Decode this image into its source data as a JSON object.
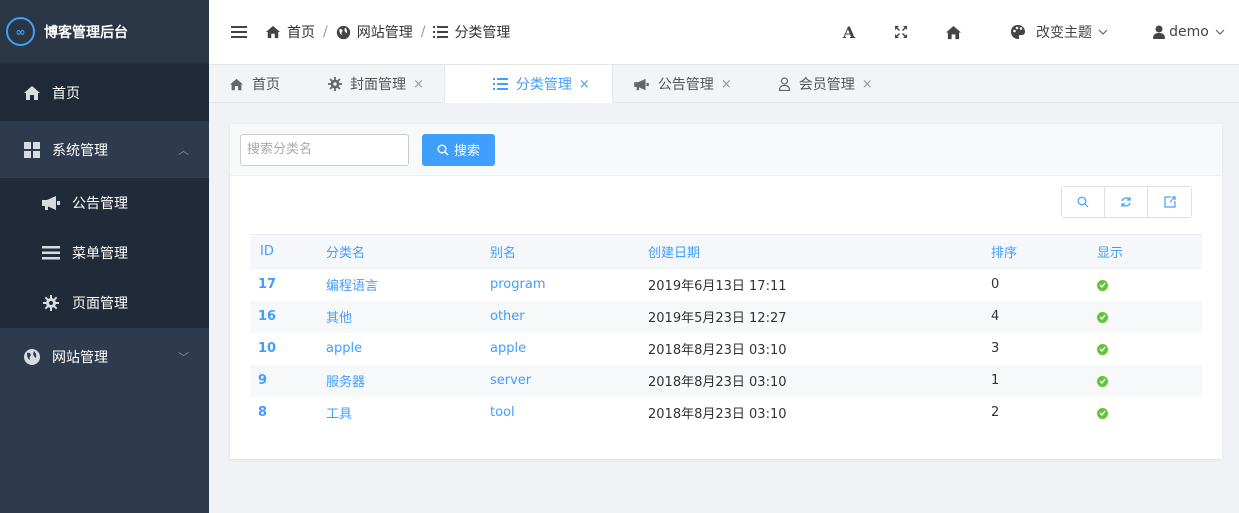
{
  "app": {
    "title": "博客管理后台",
    "logo_text": "∞"
  },
  "sidebar": {
    "items": [
      {
        "label": "首页"
      },
      {
        "label": "系统管理",
        "arrow": "︿"
      },
      {
        "label": "网站管理",
        "arrow": "﹀"
      }
    ],
    "sub_items": [
      {
        "label": "公告管理"
      },
      {
        "label": "菜单管理"
      },
      {
        "label": "页面管理"
      }
    ]
  },
  "header": {
    "breadcrumb": [
      "首页",
      "网站管理",
      "分类管理"
    ],
    "separator": "/",
    "font_tool": "A",
    "theme_label": "改变主题",
    "user": "demo"
  },
  "tabs": [
    {
      "label": "首页"
    },
    {
      "label": "封面管理",
      "close": "×"
    },
    {
      "label": "分类管理",
      "close": "×"
    },
    {
      "label": "公告管理",
      "close": "×"
    },
    {
      "label": "会员管理",
      "close": "×"
    }
  ],
  "search": {
    "placeholder": "搜索分类名",
    "button_label": "搜索"
  },
  "table": {
    "headers": [
      "ID",
      "分类名",
      "别名",
      "创建日期",
      "排序",
      "显示"
    ],
    "rows": [
      {
        "id": "17",
        "name": "编程语言",
        "alias": "program",
        "date": "2019年6月13日 17:11",
        "sort": "0"
      },
      {
        "id": "16",
        "name": "其他",
        "alias": "other",
        "date": "2019年5月23日 12:27",
        "sort": "4"
      },
      {
        "id": "10",
        "name": "apple",
        "alias": "apple",
        "date": "2018年8月23日 03:10",
        "sort": "3"
      },
      {
        "id": "9",
        "name": "服务器",
        "alias": "server",
        "date": "2018年8月23日 03:10",
        "sort": "1"
      },
      {
        "id": "8",
        "name": "工具",
        "alias": "tool",
        "date": "2018年8月23日 03:10",
        "sort": "2"
      }
    ]
  },
  "colors": {
    "accent": "#409eff",
    "sidebar": "#2e3a4d",
    "sidebar_dark": "#1f2937",
    "success": "#67c23a"
  },
  "icons": [
    "home-icon",
    "grid-icon",
    "megaphone-icon",
    "list-icon",
    "gear-icon",
    "globe-icon",
    "user-icon",
    "palette-icon",
    "expand-icon",
    "search-icon",
    "refresh-icon",
    "export-icon",
    "check-icon"
  ]
}
